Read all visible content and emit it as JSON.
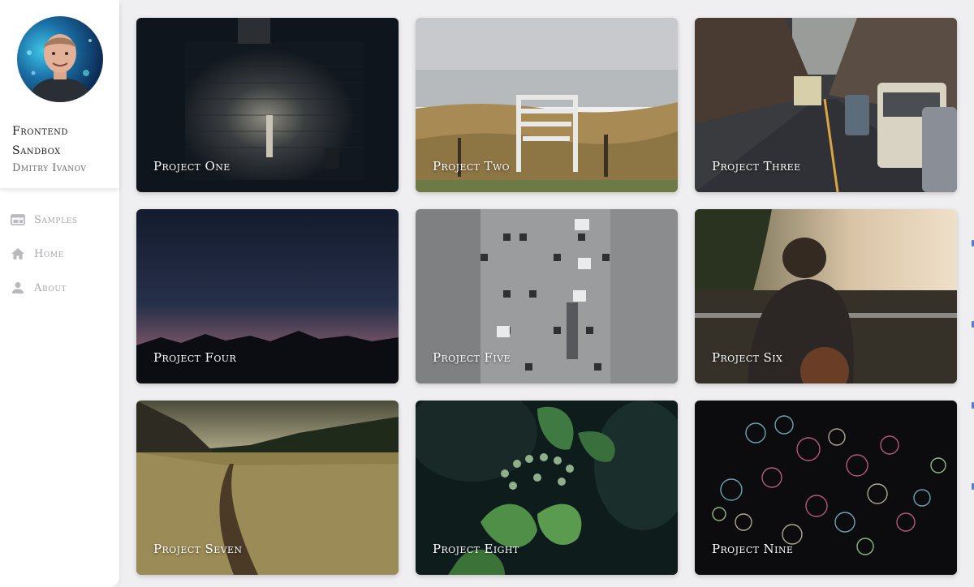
{
  "sidebar": {
    "brand_line1": "Frontend",
    "brand_line2": "Sandbox",
    "author": "Dmitry Ivanov",
    "nav": [
      {
        "label": "Samples",
        "icon": "web-icon"
      },
      {
        "label": "Home",
        "icon": "home-icon"
      },
      {
        "label": "About",
        "icon": "person-icon"
      }
    ]
  },
  "projects": [
    {
      "title": "Project One"
    },
    {
      "title": "Project Two"
    },
    {
      "title": "Project Three"
    },
    {
      "title": "Project Four"
    },
    {
      "title": "Project Five"
    },
    {
      "title": "Project Six"
    },
    {
      "title": "Project Seven"
    },
    {
      "title": "Project Eight"
    },
    {
      "title": "Project Nine"
    }
  ],
  "colors": {
    "background": "#efeff1",
    "sidebar": "#ffffff",
    "nav_text": "#a8a8ad",
    "nav_icon": "#b9b9be"
  }
}
